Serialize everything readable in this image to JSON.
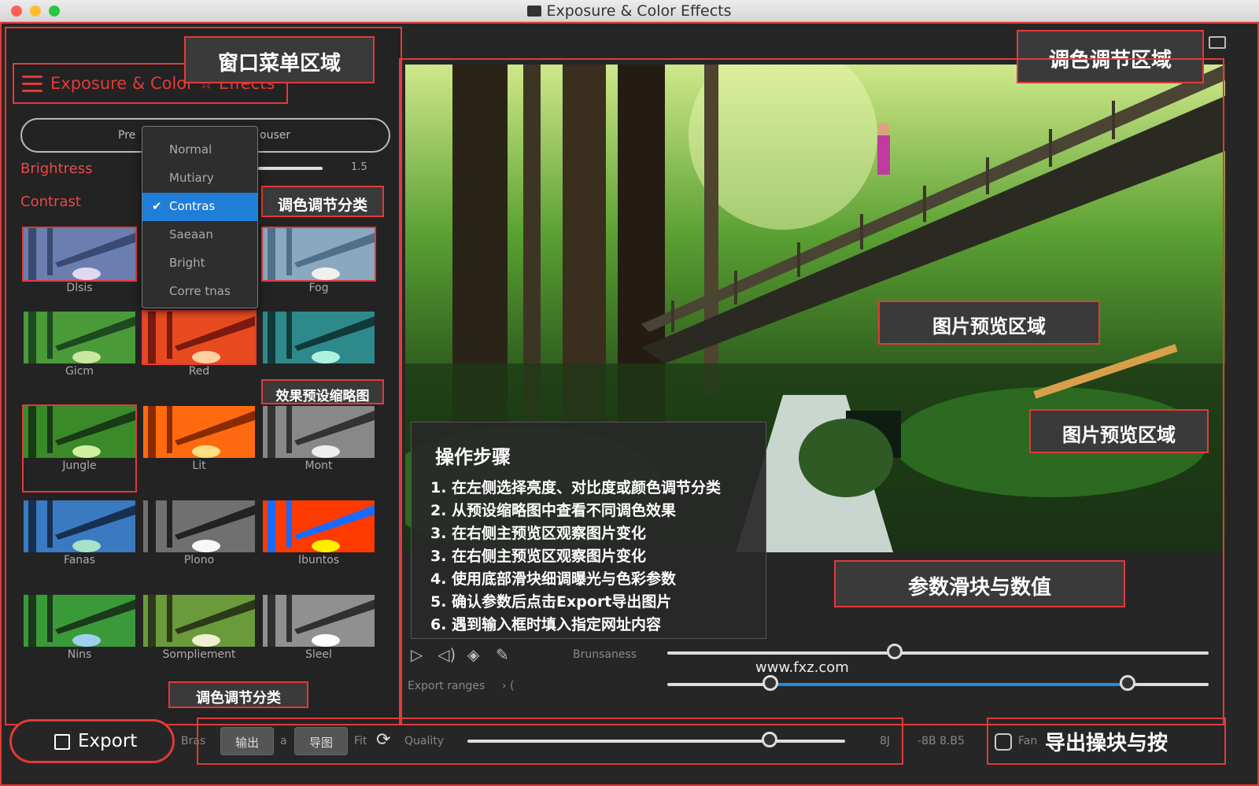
{
  "window": {
    "title": "Exposure & Color Effects"
  },
  "menu": {
    "title": "Exposure & Color ☆ Effects"
  },
  "annotations": {
    "window_menu_area": "窗口菜单区域",
    "color_adjust_area": "调色调节区域",
    "color_adjust_category": "调色调节分类",
    "effect_preset_thumbnails": "效果预设缩略图",
    "image_preview_area_1": "图片预览区域",
    "image_preview_area_2": "图片预览区域",
    "param_slider_values": "参数滑块与数值",
    "color_adjust_category_bottom": "调色调节分类",
    "export_controls": "导出操块与按"
  },
  "preset_pill": {
    "left": "Pre",
    "right": "ouser"
  },
  "params": {
    "brightness_label": "Brightress",
    "contrast_label": "Contrast",
    "brightness_value": "1.5"
  },
  "dropdown": {
    "items": [
      "Normal",
      "Mutiary",
      "Contras",
      "Saeaan",
      "Bright",
      "Corre tnas"
    ],
    "selected_index": 2
  },
  "thumbnails": [
    {
      "label": "Dlsis"
    },
    {
      "label": ""
    },
    {
      "label": "Fog"
    },
    {
      "label": "Gicm"
    },
    {
      "label": "Red"
    },
    {
      "label": ""
    },
    {
      "label": "Jungle"
    },
    {
      "label": "Lit"
    },
    {
      "label": "Mont"
    },
    {
      "label": "Fanas"
    },
    {
      "label": "Plono"
    },
    {
      "label": "Ibuntos"
    },
    {
      "label": "Nins"
    },
    {
      "label": "Sompliement"
    },
    {
      "label": "Sleel"
    }
  ],
  "steps": {
    "title": "操作步骤",
    "items": [
      "1. 在左侧选择亮度、对比度或颜色调节分类",
      "2. 从预设缩略图中查看不同调色效果",
      "3. 在右侧主预览区观察图片变化",
      "3. 在右侧主预览区观察图片变化",
      "4. 使用底部滑块细调曝光与色彩参数",
      "5. 确认参数后点击Export导出图片",
      "6. 遇到输入框时填入指定网址内容"
    ]
  },
  "controls": {
    "label_top": "Brunsaness",
    "label_export": "Export ranges",
    "url": "www.fxz.com",
    "slider1_value": 0.42,
    "range_low": 0.19,
    "range_high": 0.85
  },
  "bottom": {
    "export_label": "Export",
    "label_a": "Bras",
    "button_1": "输出",
    "sep": "a",
    "button_2": "导图",
    "label_b": "Fit",
    "quality_label": "Quality",
    "quality_value": 0.8,
    "quality_text": "8J",
    "right_text": "-8B 8.B5",
    "checkbox_label": "Fan"
  },
  "colors": {
    "accent_red": "#e23a3a",
    "select_blue": "#1f7ed8",
    "range_blue": "#1f8ee0"
  }
}
